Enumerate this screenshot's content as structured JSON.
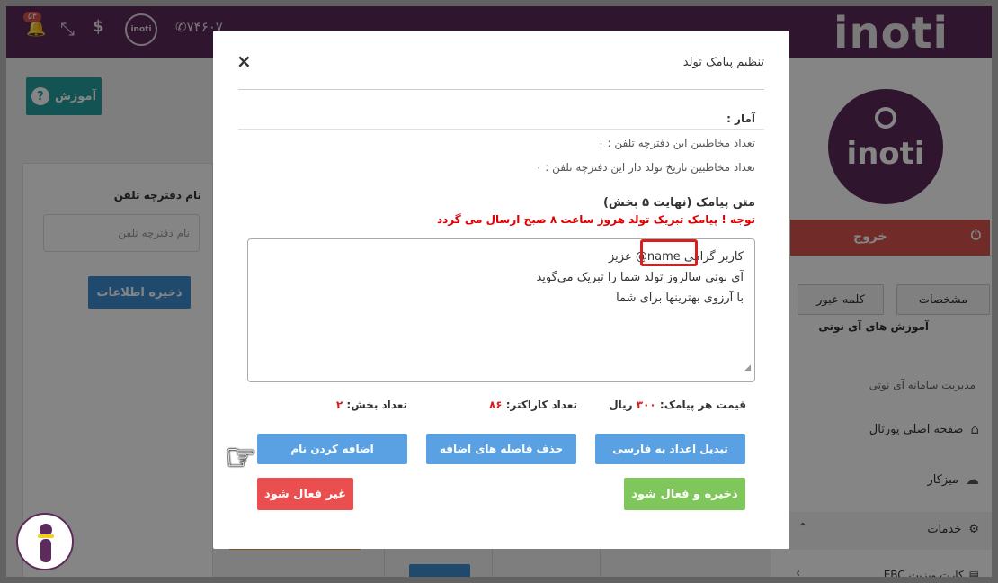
{
  "topbar": {
    "notif_count": "۵۳",
    "phone": "۷۴۶۰۷",
    "brand": "inoti",
    "logo_text": "inoti",
    "dollar": "$"
  },
  "left": {
    "help_label": "آموزش",
    "phonebook_label": "نام دفترچه تلفن",
    "phonebook_placeholder": "نام دفترچه تلفن",
    "save_label": "ذخیره اطلاعات"
  },
  "sidebar": {
    "logo_word": "inoti",
    "logout": "خروج",
    "tab_password": "کلمه عبور",
    "tab_specs": "مشخصات",
    "help_link": "آموزش های آی نوتی",
    "management": "مدیریت سامانه آی نوتی",
    "links": [
      "صفحه اصلی پورتال",
      "میزکار"
    ],
    "services": "خدمات",
    "ebc": "کارت ویزیت EBC"
  },
  "modal": {
    "title": "تنظیم پیامک تولد",
    "close": "×",
    "stats_head": "آمار :",
    "stat_contacts": "تعداد مخاطبین این دفترچه تلفن : ۰",
    "stat_birthdays": "تعداد مخاطبین تاریخ تولد دار این دفترچه تلفن : ۰",
    "sms_title": "متن پیامک (نهایت ۵ بخش)",
    "warning": "توجه ! پیامک تبریک تولد هروز ساعت ۸ صبح ارسال می گردد",
    "message_lines": [
      "کاربر گرامی name@ عزیز",
      "آی نوتی سالروز تولد شما را تبریک می‌گوید",
      "با آرزوی بهترینها برای شما"
    ],
    "price_label": "قیمت هر پیامک:",
    "price_value": "۳۰۰",
    "price_unit": "ریال",
    "chars_label": "تعداد کاراکتر:",
    "chars_value": "۸۶",
    "parts_label": "تعداد بخش:",
    "parts_value": "۲",
    "btn_convert_digits": "تبدیل اعداد به فارسی",
    "btn_remove_spaces": "حذف فاصله های اضافه",
    "btn_add_name": "اضافه کردن نام",
    "btn_save_activate": "ذخیره و فعال شود",
    "btn_deactivate": "غیر فعال شود"
  }
}
